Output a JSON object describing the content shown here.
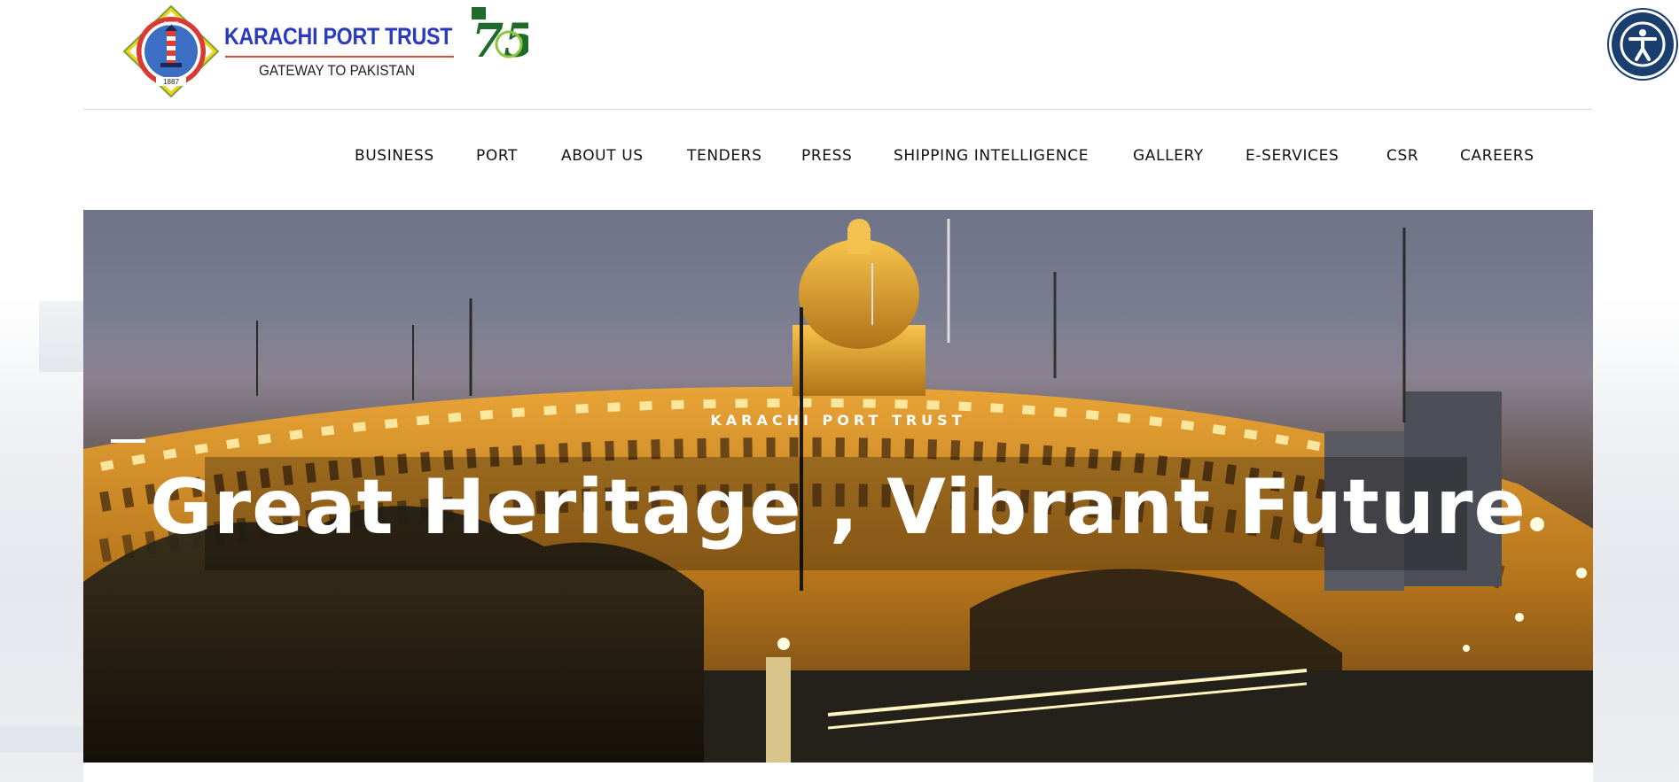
{
  "brand": {
    "title": "KARACHI PORT TRUST",
    "subtitle": "GATEWAY TO PAKISTAN",
    "logo_icon": "kpt-lighthouse-logo-icon",
    "anniversary_badge": "75",
    "logo_lettering": [
      "KARACHI",
      "PORT",
      "TRUST",
      "1887"
    ]
  },
  "nav": {
    "items": [
      {
        "label": "BUSINESS"
      },
      {
        "label": "PORT"
      },
      {
        "label": "ABOUT US"
      },
      {
        "label": "TENDERS"
      },
      {
        "label": "PRESS"
      },
      {
        "label": "SHIPPING INTELLIGENCE"
      },
      {
        "label": "GALLERY"
      },
      {
        "label": "E-SERVICES"
      },
      {
        "label": "CSR"
      },
      {
        "label": "CAREERS"
      }
    ]
  },
  "hero": {
    "kicker": "KARACHI PORT TRUST",
    "title": "Great Heritage , Vibrant Future"
  },
  "accessibility": {
    "icon": "accessibility-person-icon"
  },
  "colors": {
    "brand_blue": "#2a3bbd",
    "brand_red": "#e0463c",
    "badge_green": "#1f6b2c",
    "accessibility_navy": "#1a3e6e"
  }
}
